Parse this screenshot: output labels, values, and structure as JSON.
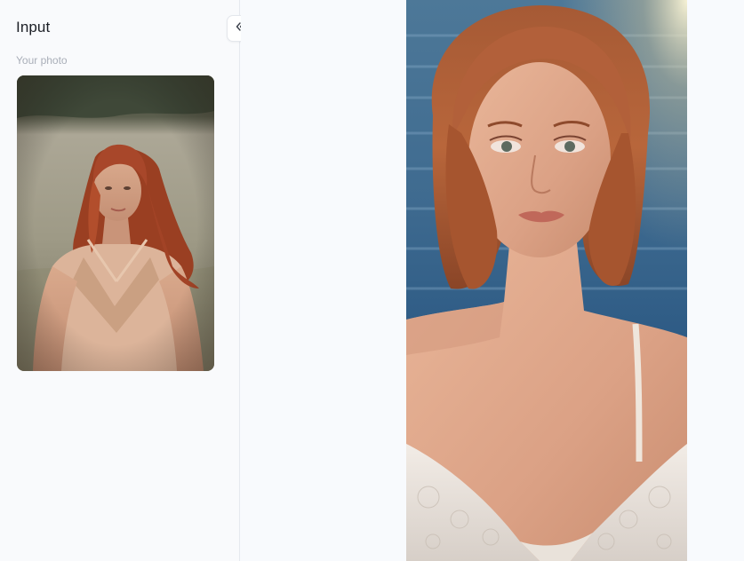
{
  "sidebar": {
    "title": "Input",
    "section_label": "Your photo",
    "collapse_icon": "chevrons-left-icon"
  },
  "input_photo": {
    "description_icon": "input-photo"
  },
  "output_photo": {
    "description_icon": "result-photo"
  },
  "colors": {
    "background": "#f8fafd",
    "sidebar_border": "#e6e9ef",
    "title": "#1c1f26",
    "muted": "#a9aeb8"
  }
}
